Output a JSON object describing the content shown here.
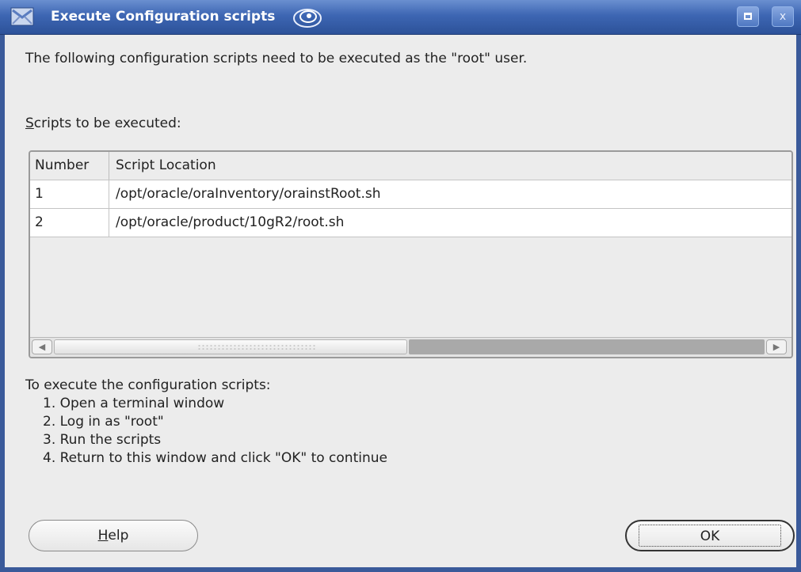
{
  "window": {
    "title": "Execute Configuration scripts",
    "maximize_label": "",
    "close_label": "x"
  },
  "intro_text": "The following configuration scripts need to be executed as the \"root\" user.",
  "scripts_label": {
    "mnemonic": "S",
    "rest": "cripts to be executed:"
  },
  "table": {
    "columns": [
      "Number",
      "Script Location"
    ],
    "rows": [
      {
        "number": "1",
        "location": "/opt/oracle/oraInventory/orainstRoot.sh"
      },
      {
        "number": "2",
        "location": "/opt/oracle/product/10gR2/root.sh"
      }
    ]
  },
  "instructions": {
    "heading": "To execute the configuration scripts:",
    "steps": [
      "1. Open a terminal window",
      "2. Log in as \"root\"",
      "3. Run the scripts",
      "4. Return to this window and click \"OK\" to continue"
    ]
  },
  "buttons": {
    "help": {
      "mnemonic": "H",
      "rest": "elp"
    },
    "ok": "OK"
  },
  "colors": {
    "titlebar": "#3d66b3",
    "window_bg": "#ececec",
    "row_bg": "#ffffff"
  }
}
